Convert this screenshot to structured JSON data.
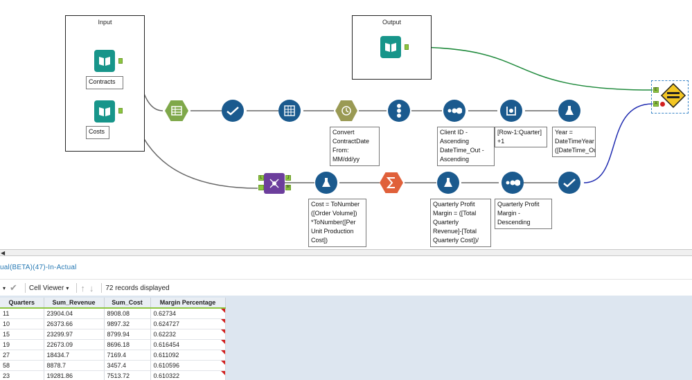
{
  "canvas": {
    "containers": [
      {
        "title": "Input"
      },
      {
        "title": "Output"
      }
    ],
    "inputs": [
      {
        "label": "Contracts"
      },
      {
        "label": "Costs"
      }
    ],
    "annotations": {
      "datetime": "Convert\nContractDate\nFrom:\nMM/dd/yy",
      "sort1": "Client ID -\nAscending\nDateTime_Out -\nAscending",
      "multirow": "[Row-1:Quarter]\n+1",
      "formula_year": "Year =\nDateTimeYear\n([DateTime_Out])",
      "formula_cost": "Cost = ToNumber\n([Order Volume])\n*ToNumber([Per\nUnit Production\nCost])",
      "formula_margin": "Quarterly Profit\nMargin = ([Total\nQuarterly\nRevenue]-[Total\nQuarterly Cost])/",
      "sort2": "Quarterly Profit\nMargin -\nDescending"
    },
    "join_anchors": [
      "L",
      "J",
      "R"
    ],
    "compare_anchors": [
      "E",
      "A"
    ]
  },
  "results": {
    "title": "ual(BETA)(47)-In-Actual",
    "toolbar": {
      "view_label": "Cell Viewer",
      "records_label": "72 records displayed"
    },
    "columns": [
      "Quarters",
      "Sum_Revenue",
      "Sum_Cost",
      "Margin Percentage"
    ],
    "rows": [
      [
        "11",
        "23904.04",
        "8908.08",
        "0.62734"
      ],
      [
        "10",
        "26373.66",
        "9897.32",
        "0.624727"
      ],
      [
        "15",
        "23299.97",
        "8799.94",
        "0.62232"
      ],
      [
        "19",
        "22673.09",
        "8696.18",
        "0.616454"
      ],
      [
        "27",
        "18434.7",
        "7169.4",
        "0.611092"
      ],
      [
        "58",
        "8878.7",
        "3457.4",
        "0.610596"
      ],
      [
        "23",
        "19281.86",
        "7513.72",
        "0.610322"
      ]
    ]
  },
  "colors": {
    "tool_blue": "#1b5a8e",
    "tool_teal": "#17958a",
    "anchor_green": "#8cc63f",
    "wire_green": "#1f8a3c",
    "wire_blue": "#1f2bb0",
    "link_blue": "#2477b3"
  }
}
